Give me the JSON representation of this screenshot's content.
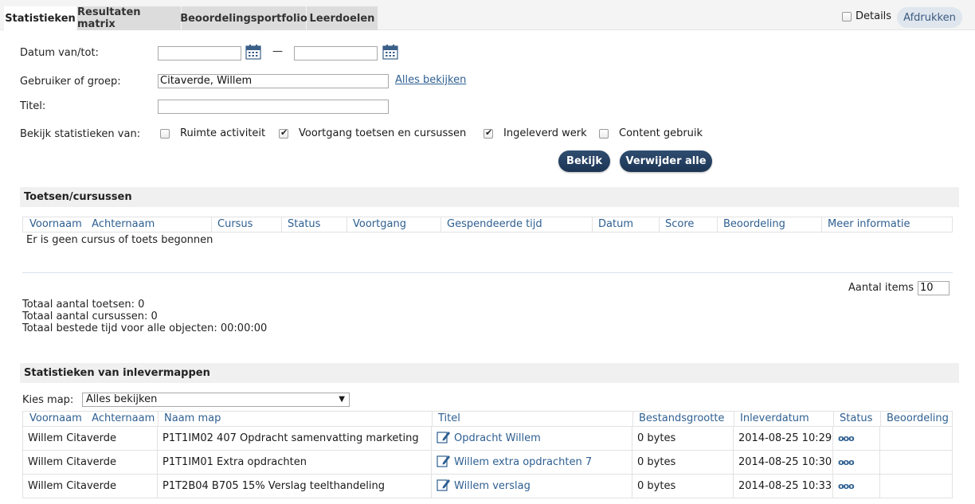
{
  "tabs": [
    {
      "label": "Statistieken",
      "active": true
    },
    {
      "label": "Resultaten matrix",
      "active": false
    },
    {
      "label": "Beoordelingsportfolio",
      "active": false
    },
    {
      "label": "Leerdoelen",
      "active": false
    }
  ],
  "header": {
    "details_label": "Details",
    "details_checked": false,
    "print_label": "Afdrukken"
  },
  "filters": {
    "date_label": "Datum van/tot:",
    "date_from": "",
    "date_to": "",
    "date_separator": "—",
    "user_label": "Gebruiker of groep:",
    "user_value": "Citaverde, Willem",
    "view_all_link": "Alles bekijken",
    "title_label": "Titel:",
    "title_value": "",
    "stats_label": "Bekijk statistieken van:",
    "options": [
      {
        "label": "Ruimte activiteit",
        "checked": false
      },
      {
        "label": "Voortgang toetsen en cursussen",
        "checked": true
      },
      {
        "label": "Ingeleverd werk",
        "checked": true
      },
      {
        "label": "Content gebruik",
        "checked": false
      }
    ],
    "view_button": "Bekijk",
    "remove_all_button": "Verwijder alle"
  },
  "tests_section": {
    "title": "Toetsen/cursussen",
    "columns": [
      "Voornaam",
      "Achternaam",
      "Cursus",
      "Status",
      "Voortgang",
      "Gespendeerde tijd",
      "Datum",
      "Score",
      "Beoordeling",
      "Meer informatie"
    ],
    "empty_message": "Er is geen cursus of toets begonnen",
    "items_label": "Aantal items",
    "items_value": "10",
    "totals": [
      "Totaal aantal toetsen: 0",
      "Totaal aantal cursussen: 0",
      "Totaal bestede tijd voor alle objecten: 00:00:00"
    ]
  },
  "folders_section": {
    "title": "Statistieken van inlevermappen",
    "choose_label": "Kies map:",
    "choose_value": "Alles bekijken",
    "columns": [
      "Voornaam",
      "Achternaam",
      "Naam map",
      "Titel",
      "Bestandsgrootte",
      "Inleverdatum",
      "Status",
      "Beoordeling"
    ],
    "rows": [
      {
        "name": "Willem Citaverde",
        "folder": "P1T1IM02 407 Opdracht samenvatting marketing",
        "title": "Opdracht Willem",
        "size": "0 bytes",
        "date": "2014-08-25 10:29",
        "status": "ooo",
        "grade": ""
      },
      {
        "name": "Willem Citaverde",
        "folder": "P1T1IM01 Extra opdrachten",
        "title": "Willem extra opdrachten 7",
        "size": "0 bytes",
        "date": "2014-08-25 10:30",
        "status": "ooo",
        "grade": ""
      },
      {
        "name": "Willem Citaverde",
        "folder": "P1T2B04 B705 15% Verslag teelthandeling",
        "title": "Willem verslag",
        "size": "0 bytes",
        "date": "2014-08-25 10:33",
        "status": "ooo",
        "grade": ""
      }
    ]
  },
  "colors": {
    "accent": "#2e5f91",
    "button": "#1c3454",
    "section_bg": "#f0f0f0"
  }
}
